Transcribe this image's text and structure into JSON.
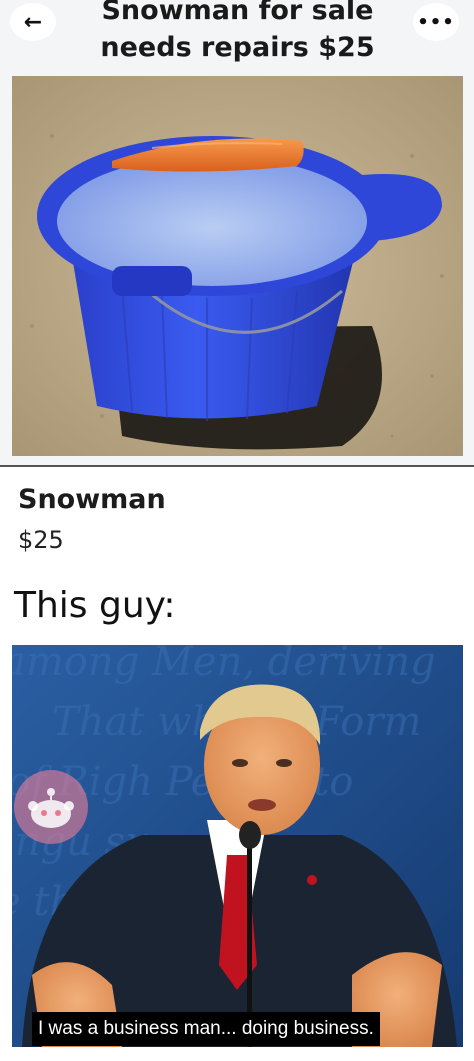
{
  "post": {
    "title": "Snowman for sale\nneeds repairs $25",
    "back_icon": "back-arrow-icon",
    "more_icon": "more-options-icon",
    "back_glyph": "←",
    "more_glyph": "•••"
  },
  "listing": {
    "title": "Snowman",
    "price": "$25"
  },
  "meme": {
    "caption": "This guy:",
    "subtitle": "I was a business man... doing business."
  },
  "colors": {
    "bucket_blue": "#2f52e6",
    "carrot_orange": "#f07a2c",
    "suit_navy": "#1b2433",
    "tie_red": "#c1121f",
    "backdrop_blue": "#1f4f8f"
  }
}
